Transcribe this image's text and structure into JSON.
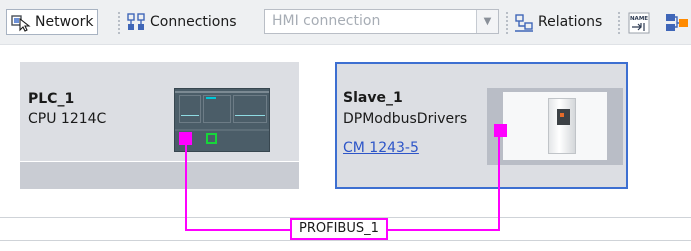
{
  "toolbar": {
    "network_label": "Network",
    "connections_label": "Connections",
    "connection_type": "HMI connection",
    "relations_label": "Relations",
    "name_icon_text": "NAME"
  },
  "devices": {
    "plc": {
      "name": "PLC_1",
      "type": "CPU 1214C"
    },
    "slave": {
      "name": "Slave_1",
      "type": "DPModbusDrivers",
      "module_link": "CM 1243-5"
    }
  },
  "bus": {
    "label": "PROFIBUS_1",
    "color": "#ff00ff"
  },
  "colors": {
    "selection_border": "#3d6fd1",
    "device_bg": "#dcdee3",
    "port_green": "#17d63a",
    "link": "#2d55c8"
  }
}
